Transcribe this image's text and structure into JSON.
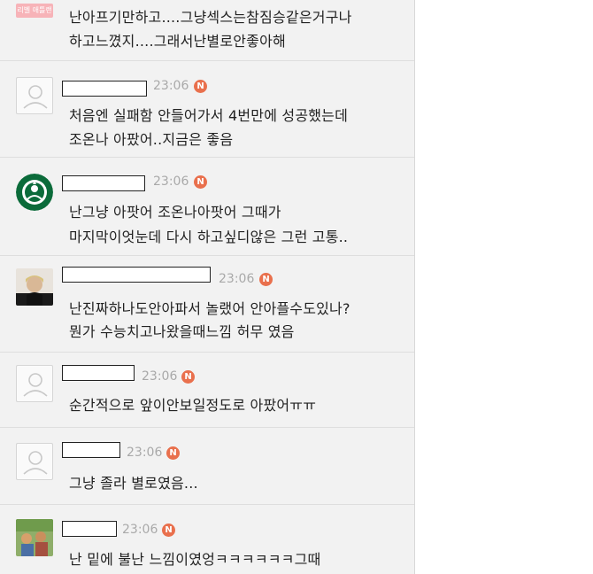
{
  "top_comment": {
    "tag": "리벨 애틀랜",
    "lines": [
      "난아프기만하고....그냥섹스는참짐승같은거구나",
      "하고느꼈지....그래서난별로안좋아해"
    ]
  },
  "comments": [
    {
      "time": "23:06",
      "badge": "N",
      "avatar": "default",
      "lines": [
        "처음엔 실패함 안들어가서 4번만에 성공했는데",
        "조온나 아팠어..지금은 좋음"
      ]
    },
    {
      "time": "23:06",
      "badge": "N",
      "avatar": "starbucks",
      "lines": [
        "난그냥 아팟어 조온나아팟어 그때가",
        "마지막이엇눈데 다시 하고싶디않은 그런 고통.."
      ]
    },
    {
      "time": "23:06",
      "badge": "N",
      "avatar": "portrait",
      "lines": [
        "난진짜하나도안아파서 놀랬어 안아플수도있나?",
        "뭔가 수능치고나왔을때느낌 허무 였음"
      ]
    },
    {
      "time": "23:06",
      "badge": "N",
      "avatar": "default",
      "lines": [
        "순간적으로 앞이안보일정도로 아팠어ㅠㅠ"
      ]
    },
    {
      "time": "23:06",
      "badge": "N",
      "avatar": "default",
      "lines": [
        "그냥 졸라 별로였음..."
      ]
    },
    {
      "time": "23:06",
      "badge": "N",
      "avatar": "photo",
      "lines": [
        "난 밑에 불난 느낌이였엉ㅋㅋㅋㅋㅋㅋ그때"
      ]
    }
  ]
}
